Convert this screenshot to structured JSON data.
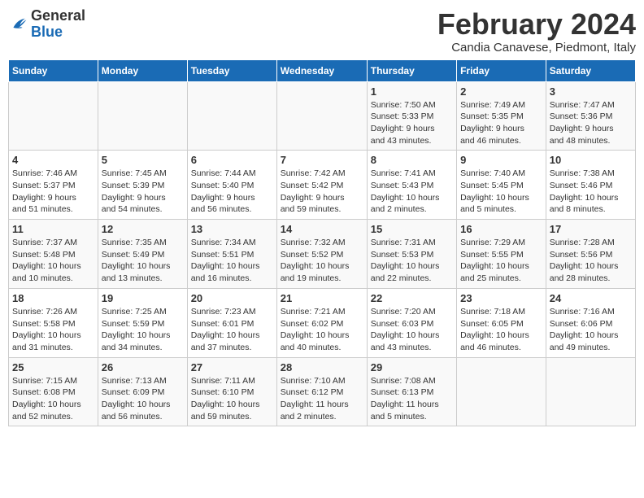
{
  "logo": {
    "general": "General",
    "blue": "Blue"
  },
  "title": "February 2024",
  "location": "Candia Canavese, Piedmont, Italy",
  "columns": [
    "Sunday",
    "Monday",
    "Tuesday",
    "Wednesday",
    "Thursday",
    "Friday",
    "Saturday"
  ],
  "weeks": [
    [
      {
        "day": "",
        "info": ""
      },
      {
        "day": "",
        "info": ""
      },
      {
        "day": "",
        "info": ""
      },
      {
        "day": "",
        "info": ""
      },
      {
        "day": "1",
        "info": "Sunrise: 7:50 AM\nSunset: 5:33 PM\nDaylight: 9 hours\nand 43 minutes."
      },
      {
        "day": "2",
        "info": "Sunrise: 7:49 AM\nSunset: 5:35 PM\nDaylight: 9 hours\nand 46 minutes."
      },
      {
        "day": "3",
        "info": "Sunrise: 7:47 AM\nSunset: 5:36 PM\nDaylight: 9 hours\nand 48 minutes."
      }
    ],
    [
      {
        "day": "4",
        "info": "Sunrise: 7:46 AM\nSunset: 5:37 PM\nDaylight: 9 hours\nand 51 minutes."
      },
      {
        "day": "5",
        "info": "Sunrise: 7:45 AM\nSunset: 5:39 PM\nDaylight: 9 hours\nand 54 minutes."
      },
      {
        "day": "6",
        "info": "Sunrise: 7:44 AM\nSunset: 5:40 PM\nDaylight: 9 hours\nand 56 minutes."
      },
      {
        "day": "7",
        "info": "Sunrise: 7:42 AM\nSunset: 5:42 PM\nDaylight: 9 hours\nand 59 minutes."
      },
      {
        "day": "8",
        "info": "Sunrise: 7:41 AM\nSunset: 5:43 PM\nDaylight: 10 hours\nand 2 minutes."
      },
      {
        "day": "9",
        "info": "Sunrise: 7:40 AM\nSunset: 5:45 PM\nDaylight: 10 hours\nand 5 minutes."
      },
      {
        "day": "10",
        "info": "Sunrise: 7:38 AM\nSunset: 5:46 PM\nDaylight: 10 hours\nand 8 minutes."
      }
    ],
    [
      {
        "day": "11",
        "info": "Sunrise: 7:37 AM\nSunset: 5:48 PM\nDaylight: 10 hours\nand 10 minutes."
      },
      {
        "day": "12",
        "info": "Sunrise: 7:35 AM\nSunset: 5:49 PM\nDaylight: 10 hours\nand 13 minutes."
      },
      {
        "day": "13",
        "info": "Sunrise: 7:34 AM\nSunset: 5:51 PM\nDaylight: 10 hours\nand 16 minutes."
      },
      {
        "day": "14",
        "info": "Sunrise: 7:32 AM\nSunset: 5:52 PM\nDaylight: 10 hours\nand 19 minutes."
      },
      {
        "day": "15",
        "info": "Sunrise: 7:31 AM\nSunset: 5:53 PM\nDaylight: 10 hours\nand 22 minutes."
      },
      {
        "day": "16",
        "info": "Sunrise: 7:29 AM\nSunset: 5:55 PM\nDaylight: 10 hours\nand 25 minutes."
      },
      {
        "day": "17",
        "info": "Sunrise: 7:28 AM\nSunset: 5:56 PM\nDaylight: 10 hours\nand 28 minutes."
      }
    ],
    [
      {
        "day": "18",
        "info": "Sunrise: 7:26 AM\nSunset: 5:58 PM\nDaylight: 10 hours\nand 31 minutes."
      },
      {
        "day": "19",
        "info": "Sunrise: 7:25 AM\nSunset: 5:59 PM\nDaylight: 10 hours\nand 34 minutes."
      },
      {
        "day": "20",
        "info": "Sunrise: 7:23 AM\nSunset: 6:01 PM\nDaylight: 10 hours\nand 37 minutes."
      },
      {
        "day": "21",
        "info": "Sunrise: 7:21 AM\nSunset: 6:02 PM\nDaylight: 10 hours\nand 40 minutes."
      },
      {
        "day": "22",
        "info": "Sunrise: 7:20 AM\nSunset: 6:03 PM\nDaylight: 10 hours\nand 43 minutes."
      },
      {
        "day": "23",
        "info": "Sunrise: 7:18 AM\nSunset: 6:05 PM\nDaylight: 10 hours\nand 46 minutes."
      },
      {
        "day": "24",
        "info": "Sunrise: 7:16 AM\nSunset: 6:06 PM\nDaylight: 10 hours\nand 49 minutes."
      }
    ],
    [
      {
        "day": "25",
        "info": "Sunrise: 7:15 AM\nSunset: 6:08 PM\nDaylight: 10 hours\nand 52 minutes."
      },
      {
        "day": "26",
        "info": "Sunrise: 7:13 AM\nSunset: 6:09 PM\nDaylight: 10 hours\nand 56 minutes."
      },
      {
        "day": "27",
        "info": "Sunrise: 7:11 AM\nSunset: 6:10 PM\nDaylight: 10 hours\nand 59 minutes."
      },
      {
        "day": "28",
        "info": "Sunrise: 7:10 AM\nSunset: 6:12 PM\nDaylight: 11 hours\nand 2 minutes."
      },
      {
        "day": "29",
        "info": "Sunrise: 7:08 AM\nSunset: 6:13 PM\nDaylight: 11 hours\nand 5 minutes."
      },
      {
        "day": "",
        "info": ""
      },
      {
        "day": "",
        "info": ""
      }
    ]
  ]
}
